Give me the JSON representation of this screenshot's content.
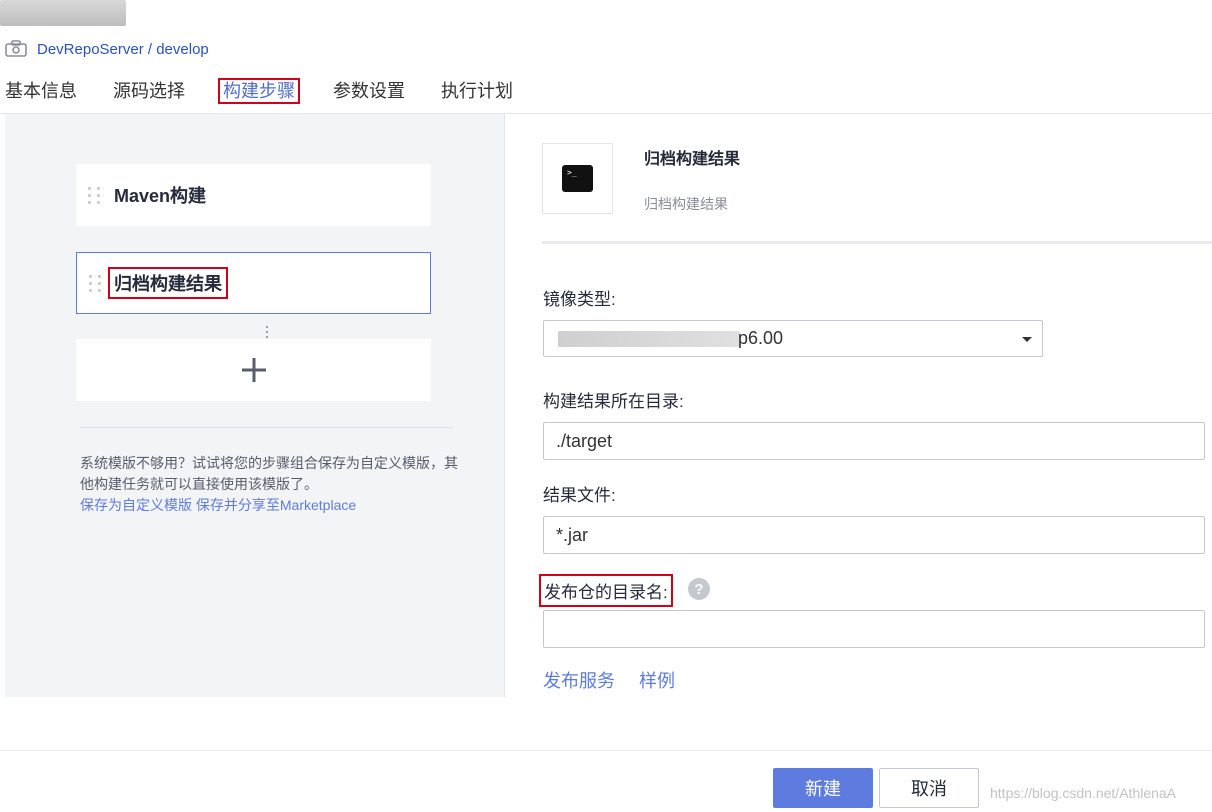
{
  "header": {
    "repo_link": "DevRepoServer / develop"
  },
  "tabs": [
    {
      "label": "基本信息"
    },
    {
      "label": "源码选择"
    },
    {
      "label": "构建步骤"
    },
    {
      "label": "参数设置"
    },
    {
      "label": "执行计划"
    }
  ],
  "steps": {
    "items": [
      {
        "label": "Maven构建"
      },
      {
        "label": "归档构建结果"
      }
    ],
    "add_symbol": "+",
    "hint_text": "系统模版不够用？试试将您的步骤组合保存为自定义模版，其他构建任务就可以直接使用该模版了。",
    "save_template_link": "保存为自定义模版",
    "share_marketplace_link": "保存并分享至Marketplace"
  },
  "detail": {
    "icon": "terminal-icon",
    "title": "归档构建结果",
    "description": "归档构建结果",
    "image_type_label": "镜像类型:",
    "image_type_value": "p6.00",
    "output_dir_label": "构建结果所在目录:",
    "output_dir_value": "./target",
    "result_file_label": "结果文件:",
    "result_file_value": "*.jar",
    "release_dir_label": "发布仓的目录名:",
    "release_dir_value": "",
    "help_symbol": "?",
    "publish_service_link": "发布服务",
    "example_link": "样例"
  },
  "footer": {
    "create_button": "新建",
    "cancel_button": "取消",
    "watermark": "https://blog.csdn.net/AthlenaA"
  },
  "colors": {
    "accent": "#5e7ce0",
    "highlight_box": "#d0021b",
    "panel_bg": "#f3f4f6"
  }
}
